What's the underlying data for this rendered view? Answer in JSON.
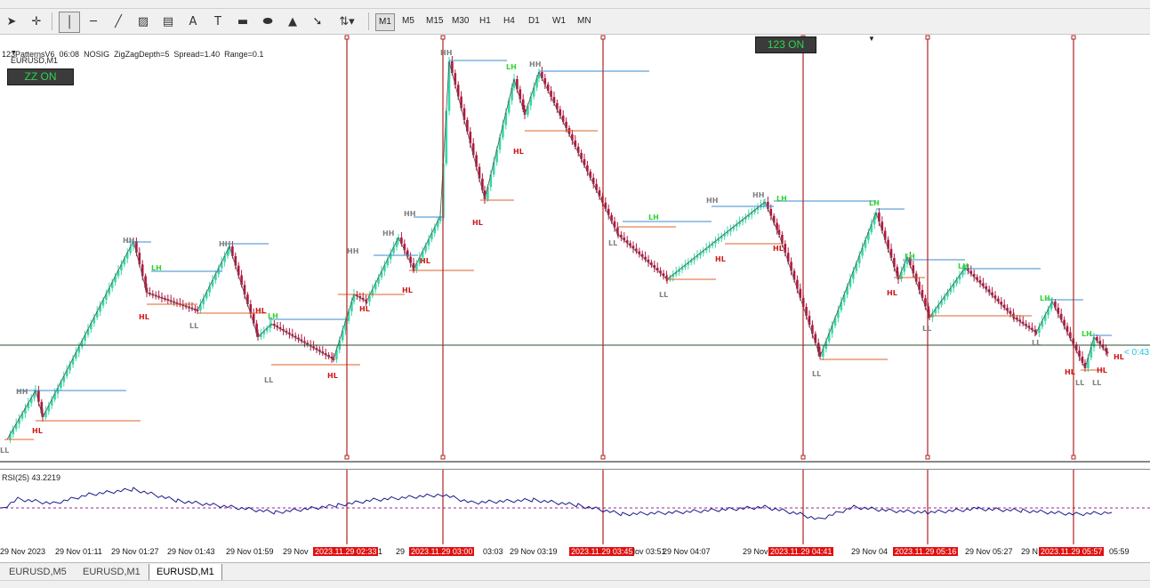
{
  "toolbar": {
    "timeframes": [
      "M1",
      "M5",
      "M15",
      "M30",
      "H1",
      "H4",
      "D1",
      "W1",
      "MN"
    ],
    "active_timeframe": "M1"
  },
  "chart": {
    "symbol_line": "EURUSD,M1",
    "indicator_line": "123PatternsV6  06:08  NOSIG  ZigZagDepth=5  Spread=1.40  Range=0.1",
    "zz_button": "ZZ ON",
    "p123_button": "123 ON",
    "price_label": "< 0:43",
    "colors": {
      "bull": "#33d9a6",
      "bear": "#b3163e",
      "zigzag": "#555555",
      "resistance": "#3a8bd1",
      "support": "#d9642a",
      "vline": "#b22222",
      "hline": "#2f4f2f",
      "rsi": "#1a1a8c",
      "rsi_level": "#a020a0"
    }
  },
  "patterns": [
    {
      "t": "HH",
      "cls": "hh"
    },
    {
      "t": "HH",
      "cls": "hh"
    },
    {
      "t": "HH",
      "cls": "hh"
    },
    {
      "t": "HH",
      "cls": "hh"
    },
    {
      "t": "HH",
      "cls": "hh"
    },
    {
      "t": "HH",
      "cls": "hh"
    },
    {
      "t": "HH",
      "cls": "hh"
    },
    {
      "t": "HH",
      "cls": "hh"
    },
    {
      "t": "HH",
      "cls": "hh"
    },
    {
      "t": "HH",
      "cls": "hh"
    },
    {
      "t": "LH",
      "cls": "lh"
    },
    {
      "t": "LH",
      "cls": "lh"
    },
    {
      "t": "LH",
      "cls": "lh"
    },
    {
      "t": "LH",
      "cls": "lh"
    },
    {
      "t": "LH",
      "cls": "lh"
    },
    {
      "t": "LH",
      "cls": "lh"
    },
    {
      "t": "LH",
      "cls": "lh"
    },
    {
      "t": "LH",
      "cls": "lh"
    },
    {
      "t": "LH",
      "cls": "lh"
    },
    {
      "t": "LH",
      "cls": "lh"
    },
    {
      "t": "HL",
      "cls": "hl"
    },
    {
      "t": "HL",
      "cls": "hl"
    },
    {
      "t": "HL",
      "cls": "hl"
    },
    {
      "t": "HL",
      "cls": "hl"
    },
    {
      "t": "HL",
      "cls": "hl"
    },
    {
      "t": "HL",
      "cls": "hl"
    },
    {
      "t": "HL",
      "cls": "hl"
    },
    {
      "t": "HL",
      "cls": "hl"
    },
    {
      "t": "HL",
      "cls": "hl"
    },
    {
      "t": "HL",
      "cls": "hl"
    },
    {
      "t": "HL",
      "cls": "hl"
    },
    {
      "t": "HL",
      "cls": "hl"
    },
    {
      "t": "HL",
      "cls": "hl"
    },
    {
      "t": "HL",
      "cls": "hl"
    },
    {
      "t": "HL",
      "cls": "hl"
    },
    {
      "t": "LL",
      "cls": "ll"
    },
    {
      "t": "LL",
      "cls": "ll"
    },
    {
      "t": "LL",
      "cls": "ll"
    },
    {
      "t": "LL",
      "cls": "ll"
    },
    {
      "t": "LL",
      "cls": "ll"
    },
    {
      "t": "LL",
      "cls": "ll"
    },
    {
      "t": "LL",
      "cls": "ll"
    },
    {
      "t": "LL",
      "cls": "ll"
    },
    {
      "t": "LL",
      "cls": "ll"
    },
    {
      "t": "LL",
      "cls": "ll"
    }
  ],
  "rsi": {
    "label": "RSI(25) 43.2219"
  },
  "time_axis": [
    {
      "t": "29 Nov 2023"
    },
    {
      "t": "29 Nov 01:11"
    },
    {
      "t": "29 Nov 01:27"
    },
    {
      "t": "29 Nov 01:43"
    },
    {
      "t": "29 Nov 01:59"
    },
    {
      "t": "29 Nov"
    },
    {
      "t": "2023.11.29 02:33",
      "hi": true
    },
    {
      "t": "1"
    },
    {
      "t": "29"
    },
    {
      "t": "2023.11.29 03:00",
      "hi": true
    },
    {
      "t": "03:03"
    },
    {
      "t": "29 Nov 03:19"
    },
    {
      "t": "2023.11.29 03:45",
      "hi": true
    },
    {
      "t": "lov 03:51"
    },
    {
      "t": "29 Nov 04:07"
    },
    {
      "t": "29 Nov"
    },
    {
      "t": "2023.11.29 04:41",
      "hi": true
    },
    {
      "t": "29 Nov 04"
    },
    {
      "t": "2023.11.29 05:16",
      "hi": true
    },
    {
      "t": "29 Nov 05:27"
    },
    {
      "t": "29 N"
    },
    {
      "t": "2023.11.29 05:57",
      "hi": true
    },
    {
      "t": "05:59"
    }
  ],
  "tabs": [
    "EURUSD,M5",
    "EURUSD,M1",
    "EURUSD,M1"
  ],
  "active_tab": 2
}
